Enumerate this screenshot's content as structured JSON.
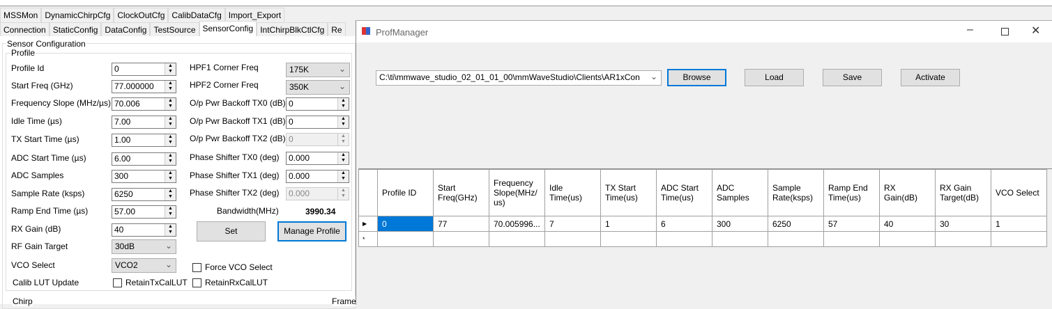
{
  "tabs_row1": [
    "MSSMon",
    "DynamicChirpCfg",
    "ClockOutCfg",
    "CalibDataCfg",
    "Import_Export"
  ],
  "tabs_row2": [
    "Connection",
    "StaticConfig",
    "DataConfig",
    "TestSource",
    "SensorConfig",
    "IntChirpBlkCtlCfg",
    "Re"
  ],
  "sensor_group": "Sensor Configuration",
  "profile_group": "Profile",
  "left_fields": [
    {
      "label": "Profile Id",
      "value": "0"
    },
    {
      "label": "Start Freq (GHz)",
      "value": "77.000000"
    },
    {
      "label": "Frequency Slope (MHz/µs)",
      "value": "70.006"
    },
    {
      "label": "Idle Time (µs)",
      "value": "7.00"
    },
    {
      "label": "TX Start Time (µs)",
      "value": "1.00"
    },
    {
      "label": "ADC Start Time (µs)",
      "value": "6.00"
    },
    {
      "label": "ADC Samples",
      "value": "300"
    },
    {
      "label": "Sample Rate (ksps)",
      "value": "6250"
    },
    {
      "label": "Ramp End Time (µs)",
      "value": "57.00"
    },
    {
      "label": "RX Gain (dB)",
      "value": "40"
    }
  ],
  "rf_gain": {
    "label": "RF Gain Target",
    "value": "30dB"
  },
  "vco": {
    "label": "VCO Select",
    "value": "VCO2"
  },
  "calib": {
    "label": "Calib LUT Update",
    "tx": "RetainTxCalLUT",
    "rx": "RetainRxCalLUT"
  },
  "force_vco": "Force VCO Select",
  "hpf1": {
    "label": "HPF1 Corner Freq",
    "value": "175K"
  },
  "hpf2": {
    "label": "HPF2 Corner Freq",
    "value": "350K"
  },
  "right_fields": [
    {
      "label": "O/p Pwr Backoff TX0 (dB)",
      "value": "0"
    },
    {
      "label": "O/p Pwr Backoff TX1 (dB)",
      "value": "0"
    },
    {
      "label": "O/p Pwr Backoff TX2 (dB)",
      "value": "0"
    },
    {
      "label": "Phase Shifter TX0 (deg)",
      "value": "0.000"
    },
    {
      "label": "Phase Shifter TX1 (deg)",
      "value": "0.000"
    },
    {
      "label": "Phase Shifter TX2 (deg)",
      "value": "0.000"
    }
  ],
  "bandwidth": {
    "label": "Bandwidth(MHz)",
    "value": "3990.34"
  },
  "set_label": "Set",
  "manage_label": "Manage Profile",
  "chirp_group": "Chirp",
  "frame_group": "Frame",
  "prof": {
    "title": "ProfManager",
    "path": "C:\\ti\\mmwave_studio_02_01_01_00\\mmWaveStudio\\Clients\\AR1xCon",
    "browse": "Browse",
    "load": "Load",
    "save": "Save",
    "activate": "Activate",
    "columns": [
      "Profile ID",
      "Start Freq(GHz)",
      "Frequency Slope(MHz/ us)",
      "Idle Time(us)",
      "TX Start Time(us)",
      "ADC Start Time(us)",
      "ADC Samples",
      "Sample Rate(ksps)",
      "Ramp End Time(us)",
      "RX Gain(dB)",
      "RX Gain Target(dB)",
      "VCO Select"
    ],
    "row": [
      "0",
      "77",
      "70.005996...",
      "7",
      "1",
      "6",
      "300",
      "6250",
      "57",
      "40",
      "30",
      "1"
    ]
  }
}
